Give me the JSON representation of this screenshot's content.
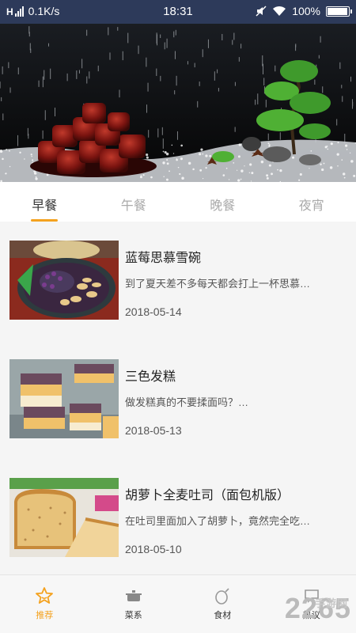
{
  "status_bar": {
    "network_speed": "0.1K/s",
    "time": "18:31",
    "battery_percent": "100%",
    "battery_level": 1.0,
    "icons": [
      "hd-signal-icon",
      "mute-icon",
      "wifi-icon",
      "battery-icon"
    ]
  },
  "banner": {
    "icon": "braised-pork-photo"
  },
  "tabs": [
    {
      "label": "早餐",
      "active": true
    },
    {
      "label": "午餐",
      "active": false
    },
    {
      "label": "晚餐",
      "active": false
    },
    {
      "label": "夜宵",
      "active": false
    }
  ],
  "recipes": [
    {
      "title": "蓝莓思慕雪碗",
      "desc": "到了夏天差不多每天都会打上一杯思慕…",
      "date": "2018-05-14",
      "image": "smoothie-bowl-photo"
    },
    {
      "title": "三色发糕",
      "desc": "做发糕真的不要揉面吗？…",
      "date": "2018-05-13",
      "image": "tricolor-cake-photo"
    },
    {
      "title": "胡萝卜全麦吐司（面包机版）",
      "desc": "在吐司里面加入了胡萝卜，竟然完全吃…",
      "date": "2018-05-10",
      "image": "carrot-toast-photo"
    }
  ],
  "bottom_nav": [
    {
      "label": "推荐",
      "icon": "star-icon",
      "active": true
    },
    {
      "label": "菜系",
      "icon": "cooking-pot-icon",
      "active": false
    },
    {
      "label": "食材",
      "icon": "ingredient-icon",
      "active": false
    },
    {
      "label": "热议",
      "icon": "discussion-icon",
      "active": false
    }
  ],
  "watermark": {
    "text": "2265",
    "sub": "手游网"
  },
  "colors": {
    "accent": "#f4a21f",
    "status_bar": "#2d3a5a",
    "text": "#222222",
    "muted": "#aaaaaa"
  }
}
